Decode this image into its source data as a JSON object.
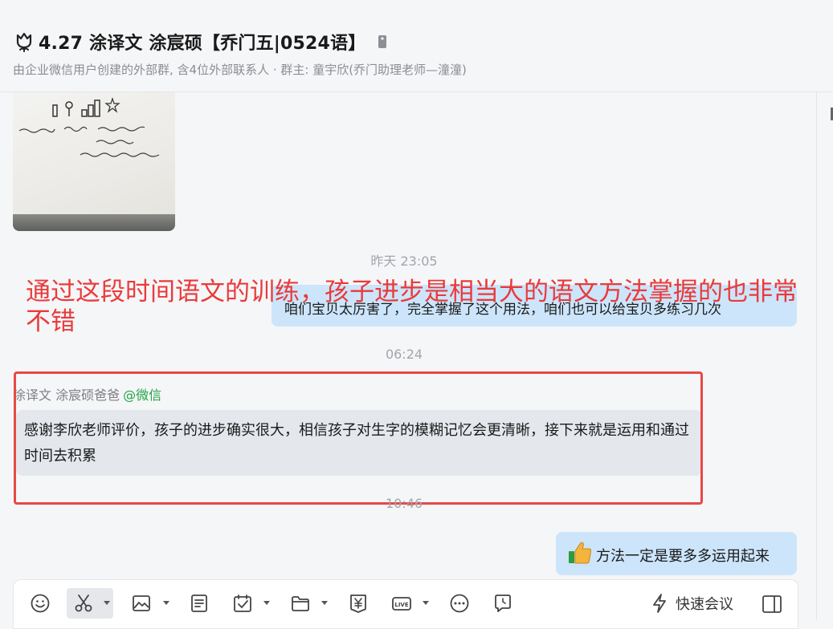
{
  "header": {
    "title": "4.27 涂译文 涂宸硕【乔门五|0524语】",
    "subtitle": "由企业微信用户创建的外部群, 含4位外部联系人 · 群主: 童宇欣(乔门助理老师—潼潼)"
  },
  "messages": {
    "time1": "昨天 23:05",
    "bubble1": "咱们宝贝太厉害了，完全掌握了这个用法，咱们也可以给宝贝多练习几次",
    "time2": "06:24",
    "sender_name": "涂译文 涂宸硕爸爸",
    "sender_source": "@微信",
    "bubble2": "感谢李欣老师评价，孩子的进步确实很大，相信孩子对生字的模糊记忆会更清晰，接下来就是运用和通过时间去积累",
    "time3": "10:46",
    "bubble3": "方法一定是要多多运用起来"
  },
  "overlay": {
    "text": "通过这段时间语文的训练，孩子进步是相当大的语文方法掌握的也非常不错"
  },
  "composer": {
    "quick_meeting": "快速会议",
    "tools": [
      "emoji-icon",
      "scissors-icon",
      "image-icon",
      "document-icon",
      "calendar-check-icon",
      "folder-icon",
      "payment-icon",
      "live-icon",
      "more-icon",
      "schedule-message-icon"
    ]
  },
  "colors": {
    "overlay_red": "#ea3a3a",
    "highlight_box": "#e84848",
    "right_bubble": "#cce5fb",
    "left_bubble": "#e4e7ec",
    "wechat_green": "#23a345"
  }
}
